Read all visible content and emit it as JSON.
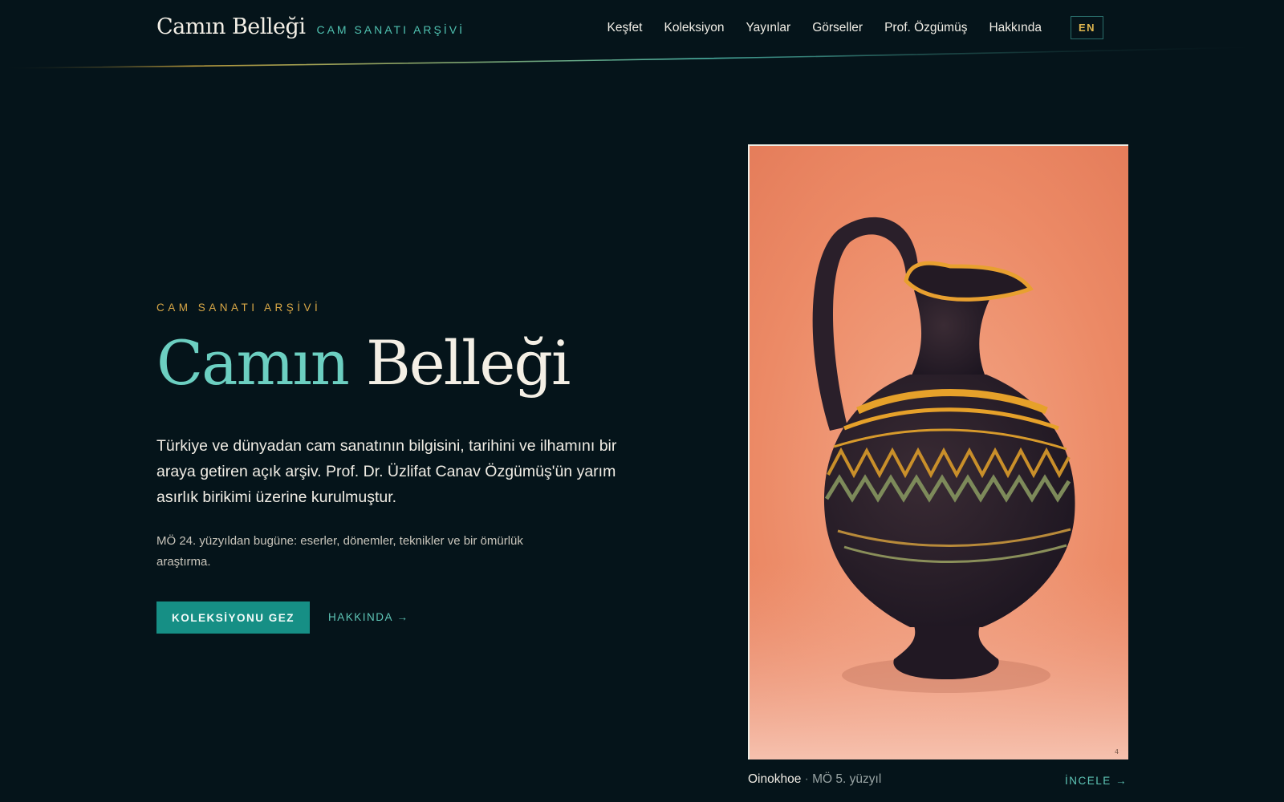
{
  "header": {
    "brand_title": "Camın Belleği",
    "brand_subtitle": "CAM SANATI ARŞİVİ",
    "nav": [
      "Keşfet",
      "Koleksiyon",
      "Yayınlar",
      "Görseller",
      "Prof. Özgümüş",
      "Hakkında"
    ],
    "lang_label": "EN"
  },
  "hero": {
    "eyebrow": "CAM SANATI ARŞİVİ",
    "title_word1": "Camın",
    "title_word2": "Belleği",
    "lead": "Türkiye ve dünyadan cam sanatının bilgisini, tarihini ve ilhamını bir araya getiren açık arşiv. Prof. Dr. Üzlifat Canav Özgümüş'ün yarım asırlık birikimi üzerine kurulmuştur.",
    "sub": "MÖ 24. yüzyıldan bugüne: eserler, dönemler, teknikler ve bir ömürlük araştırma.",
    "primary_button": "KOLEKSİYONU GEZ",
    "secondary_link": "HAKKINDA →"
  },
  "feature": {
    "image_alt": "Oinokhoe",
    "page_number": "4",
    "caption_name": "Oinokhoe",
    "caption_sep": " · ",
    "caption_date": "MÖ 5. yüzyıl",
    "link": "İNCELE →"
  },
  "colors": {
    "background": "#05141a",
    "accent_teal": "#168f85",
    "accent_gold": "#d9a847"
  }
}
